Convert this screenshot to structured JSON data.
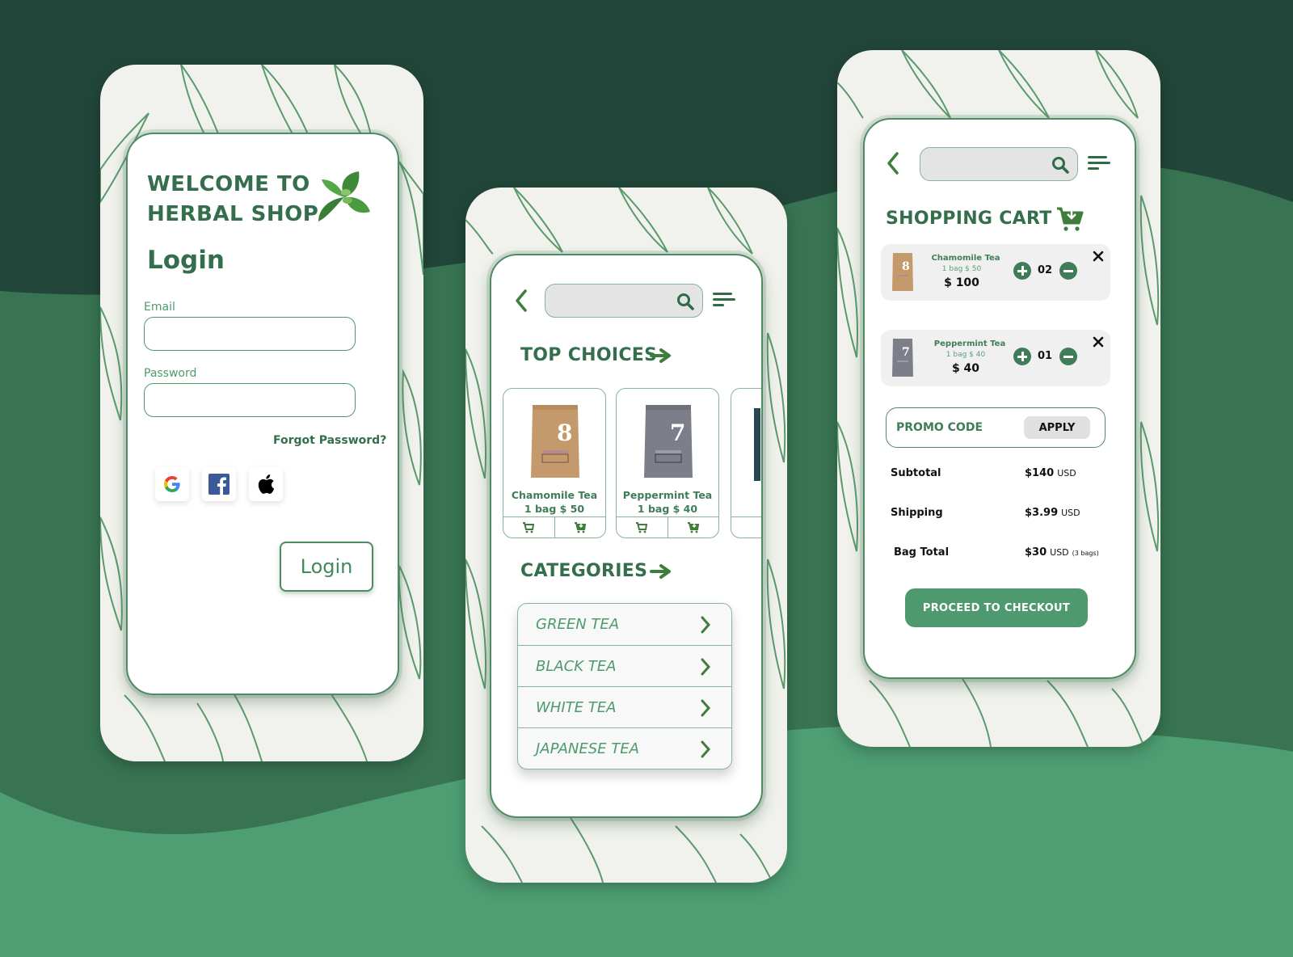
{
  "theme": {
    "bg_dark": "#22463a",
    "bg_mid": "#387452",
    "bg_light": "#4e9e72",
    "primary": "#346e4d",
    "accent": "#4e9a6e"
  },
  "login_screen": {
    "welcome_line1": "WELCOME TO",
    "welcome_line2": "HERBAL SHOP",
    "logo_icon": "basil-leaf-icon",
    "title": "Login",
    "email_label": "Email",
    "email_value": "",
    "password_label": "Password",
    "password_value": "",
    "forgot_password": "Forgot Password?",
    "social_logins": [
      {
        "name": "Google",
        "icon": "google-icon"
      },
      {
        "name": "Facebook",
        "icon": "facebook-icon"
      },
      {
        "name": "Apple",
        "icon": "apple-icon"
      }
    ],
    "login_button": "Login"
  },
  "home_screen": {
    "search_value": "",
    "top_choices_title": "TOP CHOICES",
    "products": [
      {
        "name": "Chamomile Tea",
        "price": "1 bag $ 50",
        "bag_color": "#c49a6c",
        "bag_number": "8"
      },
      {
        "name": "Peppermint Tea",
        "price": "1 bag $ 40",
        "bag_color": "#7c7f8a",
        "bag_number": "7"
      }
    ],
    "categories_title": "CATEGORIES",
    "categories": [
      {
        "label": "GREEN TEA"
      },
      {
        "label": "BLACK TEA"
      },
      {
        "label": "WHITE TEA"
      },
      {
        "label": "JAPANESE TEA"
      }
    ]
  },
  "cart_screen": {
    "search_value": "",
    "title": "SHOPPING CART",
    "items": [
      {
        "name": "Chamomile Tea",
        "unit_price": "1 bag $ 50",
        "total": "$ 100",
        "quantity": "02",
        "bag_color": "#c49a6c",
        "bag_number": "8"
      },
      {
        "name": "Peppermint Tea",
        "unit_price": "1 bag $ 40",
        "total": "$ 40",
        "quantity": "01",
        "bag_color": "#7c7f8a",
        "bag_number": "7"
      }
    ],
    "promo_placeholder": "PROMO CODE",
    "apply_button": "APPLY",
    "summary": [
      {
        "label": "Subtotal",
        "amount": "$140",
        "currency": "USD",
        "note": ""
      },
      {
        "label": "Shipping",
        "amount": "$3.99",
        "currency": "USD",
        "note": ""
      },
      {
        "label": "Bag Total",
        "amount": "$30",
        "currency": "USD",
        "note": "(3 bags)"
      }
    ],
    "checkout_button": "PROCEED TO CHECKOUT"
  }
}
